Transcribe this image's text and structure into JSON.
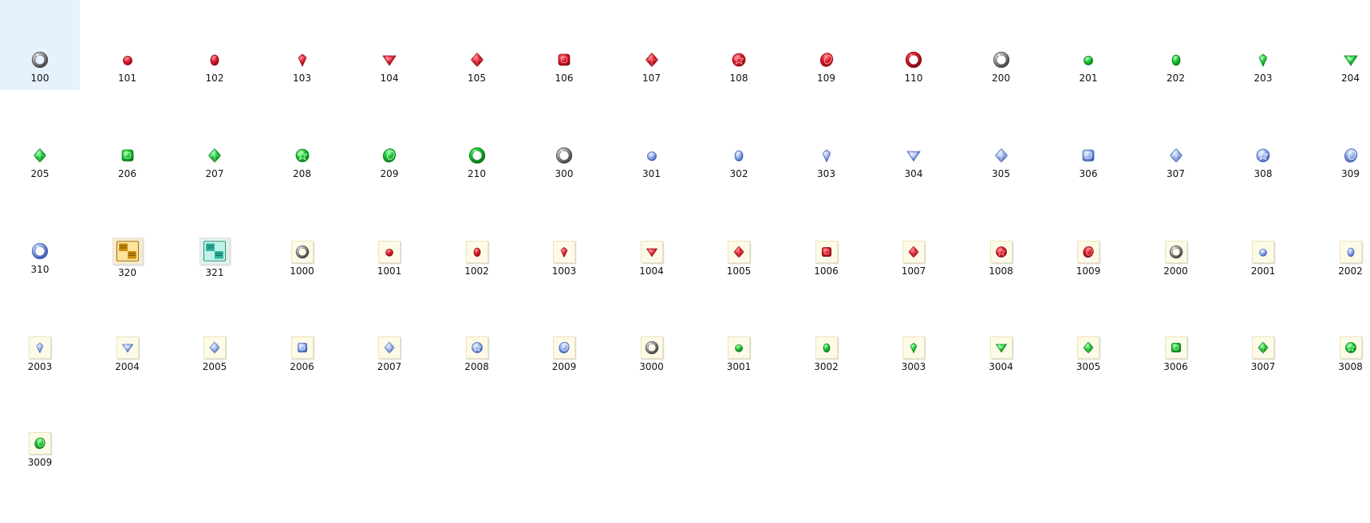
{
  "files": [
    {
      "name": "100",
      "gem": "ring",
      "color": "silver",
      "selected": true
    },
    {
      "name": "101",
      "gem": "round",
      "color": "red"
    },
    {
      "name": "102",
      "gem": "oval",
      "color": "red"
    },
    {
      "name": "103",
      "gem": "drop",
      "color": "red"
    },
    {
      "name": "104",
      "gem": "triangle",
      "color": "red"
    },
    {
      "name": "105",
      "gem": "diamond",
      "color": "red"
    },
    {
      "name": "106",
      "gem": "square",
      "color": "red"
    },
    {
      "name": "107",
      "gem": "diamond",
      "color": "red"
    },
    {
      "name": "108",
      "gem": "star",
      "color": "red"
    },
    {
      "name": "109",
      "gem": "crescent",
      "color": "red"
    },
    {
      "name": "110",
      "gem": "ring",
      "color": "red"
    },
    {
      "name": "200",
      "gem": "ring",
      "color": "silver"
    },
    {
      "name": "201",
      "gem": "round",
      "color": "green"
    },
    {
      "name": "202",
      "gem": "oval",
      "color": "green"
    },
    {
      "name": "203",
      "gem": "drop",
      "color": "green"
    },
    {
      "name": "204",
      "gem": "triangle",
      "color": "green"
    },
    {
      "name": "205",
      "gem": "diamond",
      "color": "green"
    },
    {
      "name": "206",
      "gem": "square",
      "color": "green"
    },
    {
      "name": "207",
      "gem": "diamond",
      "color": "green"
    },
    {
      "name": "208",
      "gem": "star",
      "color": "green"
    },
    {
      "name": "209",
      "gem": "crescent",
      "color": "green"
    },
    {
      "name": "210",
      "gem": "ring",
      "color": "green"
    },
    {
      "name": "300",
      "gem": "ring",
      "color": "silver"
    },
    {
      "name": "301",
      "gem": "round",
      "color": "blue"
    },
    {
      "name": "302",
      "gem": "oval",
      "color": "blue"
    },
    {
      "name": "303",
      "gem": "drop",
      "color": "blue"
    },
    {
      "name": "304",
      "gem": "triangle",
      "color": "blue"
    },
    {
      "name": "305",
      "gem": "diamond",
      "color": "blue"
    },
    {
      "name": "306",
      "gem": "square",
      "color": "blue"
    },
    {
      "name": "307",
      "gem": "diamond",
      "color": "blue"
    },
    {
      "name": "308",
      "gem": "star",
      "color": "blue"
    },
    {
      "name": "309",
      "gem": "crescent",
      "color": "blue"
    },
    {
      "name": "310",
      "gem": "ring",
      "color": "blue"
    },
    {
      "name": "320",
      "gem": "scroll",
      "color": "gold",
      "big": true
    },
    {
      "name": "321",
      "gem": "scroll",
      "color": "teal",
      "big": true
    },
    {
      "name": "1000",
      "gem": "ring",
      "color": "silver",
      "framed": true
    },
    {
      "name": "1001",
      "gem": "round",
      "color": "red",
      "framed": true
    },
    {
      "name": "1002",
      "gem": "oval",
      "color": "red",
      "framed": true
    },
    {
      "name": "1003",
      "gem": "drop",
      "color": "red",
      "framed": true
    },
    {
      "name": "1004",
      "gem": "triangle",
      "color": "red",
      "framed": true
    },
    {
      "name": "1005",
      "gem": "diamond",
      "color": "red",
      "framed": true
    },
    {
      "name": "1006",
      "gem": "square",
      "color": "red",
      "framed": true
    },
    {
      "name": "1007",
      "gem": "diamond",
      "color": "red",
      "framed": true
    },
    {
      "name": "1008",
      "gem": "star",
      "color": "red",
      "framed": true
    },
    {
      "name": "1009",
      "gem": "crescent",
      "color": "red",
      "framed": true
    },
    {
      "name": "2000",
      "gem": "ring",
      "color": "silver",
      "framed": true
    },
    {
      "name": "2001",
      "gem": "round",
      "color": "blue",
      "framed": true
    },
    {
      "name": "2002",
      "gem": "oval",
      "color": "blue",
      "framed": true
    },
    {
      "name": "2003",
      "gem": "drop",
      "color": "blue",
      "framed": true
    },
    {
      "name": "2004",
      "gem": "triangle",
      "color": "blue",
      "framed": true
    },
    {
      "name": "2005",
      "gem": "diamond",
      "color": "blue",
      "framed": true
    },
    {
      "name": "2006",
      "gem": "square",
      "color": "blue",
      "framed": true
    },
    {
      "name": "2007",
      "gem": "diamond",
      "color": "blue",
      "framed": true
    },
    {
      "name": "2008",
      "gem": "star",
      "color": "blue",
      "framed": true
    },
    {
      "name": "2009",
      "gem": "crescent",
      "color": "blue",
      "framed": true
    },
    {
      "name": "3000",
      "gem": "ring",
      "color": "silver",
      "framed": true
    },
    {
      "name": "3001",
      "gem": "round",
      "color": "green",
      "framed": true
    },
    {
      "name": "3002",
      "gem": "oval",
      "color": "green",
      "framed": true
    },
    {
      "name": "3003",
      "gem": "drop",
      "color": "green",
      "framed": true
    },
    {
      "name": "3004",
      "gem": "triangle",
      "color": "green",
      "framed": true
    },
    {
      "name": "3005",
      "gem": "diamond",
      "color": "green",
      "framed": true
    },
    {
      "name": "3006",
      "gem": "square",
      "color": "green",
      "framed": true
    },
    {
      "name": "3007",
      "gem": "diamond",
      "color": "green",
      "framed": true
    },
    {
      "name": "3008",
      "gem": "star",
      "color": "green",
      "framed": true
    },
    {
      "name": "3009",
      "gem": "crescent",
      "color": "green",
      "framed": true
    }
  ],
  "palette": {
    "red": {
      "fill": "#e0202e",
      "dark": "#8e0a14",
      "light": "#ff9aa0"
    },
    "green": {
      "fill": "#1fc93a",
      "dark": "#0a7a18",
      "light": "#b6ffbf"
    },
    "blue": {
      "fill": "#9fb4ea",
      "dark": "#3e5fb5",
      "light": "#eef3ff"
    },
    "silver": {
      "fill": "#b0b0b0",
      "dark": "#4a4a4a",
      "light": "#f2f2f2"
    },
    "gold": {
      "fill": "#c8900e",
      "dark": "#7a5200",
      "light": "#ffe39a"
    },
    "teal": {
      "fill": "#2fb59e",
      "dark": "#116e5e",
      "light": "#bff3e8"
    }
  },
  "selection_color": "#e6f1fc"
}
